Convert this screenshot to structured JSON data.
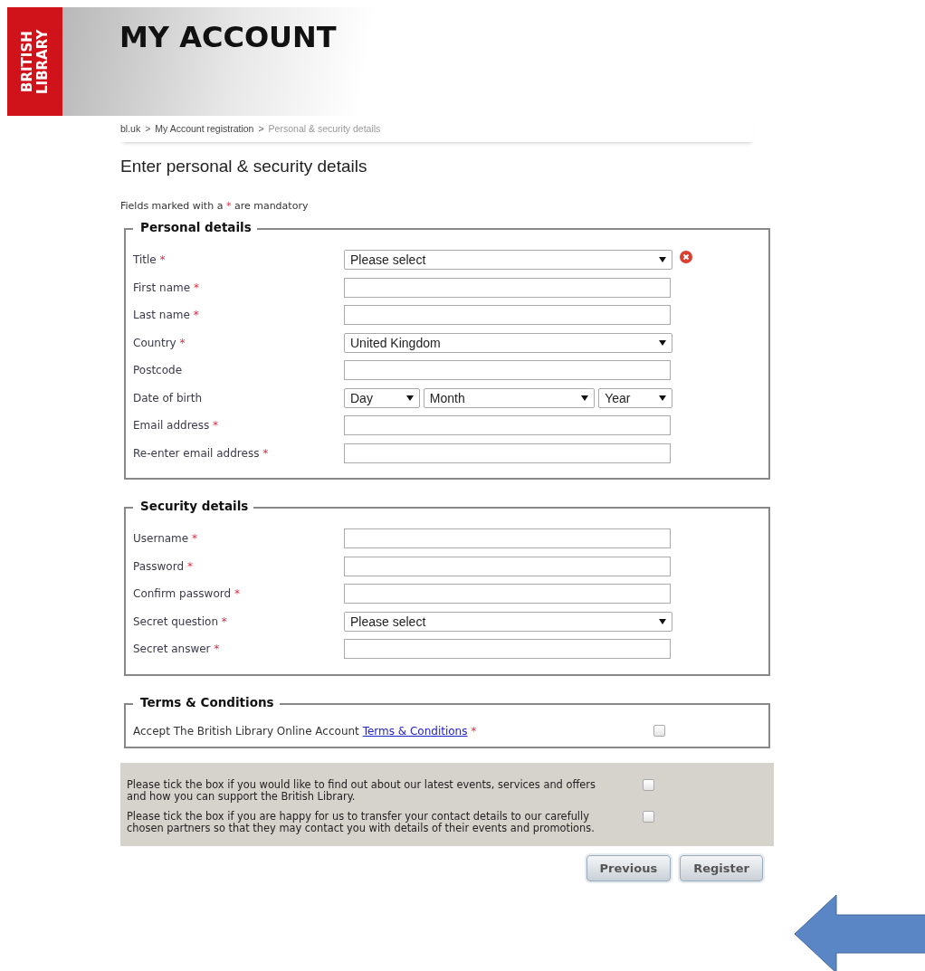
{
  "logo": [
    "BRITISH",
    "LIBRARY"
  ],
  "header": {
    "title": "MY ACCOUNT"
  },
  "breadcrumb": [
    {
      "label": "bl.uk",
      "current": false
    },
    {
      "label": "My Account registration",
      "current": false
    },
    {
      "label": "Personal & security details",
      "current": true
    }
  ],
  "breadcrumb_separator": ">",
  "page_title": "Enter personal & security details",
  "mandatory_note": {
    "before": "Fields marked with a",
    "mark": "*",
    "after": "are mandatory"
  },
  "sections": [
    {
      "legend": "Personal details",
      "fields": [
        {
          "label": "Title",
          "mark": "*",
          "kind": "select",
          "value": "Please select",
          "error": true
        },
        {
          "label": "First name",
          "mark": "*",
          "kind": "text"
        },
        {
          "label": "Last name",
          "mark": "*",
          "kind": "text"
        },
        {
          "label": "Country",
          "mark": "*",
          "kind": "select",
          "value": "United Kingdom"
        },
        {
          "label": "Postcode",
          "kind": "text"
        },
        {
          "label": "Date of birth",
          "kind": "date",
          "parts": [
            "Day",
            "Month",
            "Year"
          ]
        },
        {
          "label": "Email address",
          "mark": "*",
          "kind": "text"
        },
        {
          "label": "Re-enter email address",
          "mark": "*",
          "kind": "text"
        }
      ]
    },
    {
      "legend": "Security details",
      "fields": [
        {
          "label": "Username",
          "mark": "*",
          "kind": "text"
        },
        {
          "label": "Password",
          "mark": "*",
          "kind": "text"
        },
        {
          "label": "Confirm password",
          "mark": "*",
          "kind": "text"
        },
        {
          "label": "Secret question",
          "mark": "*",
          "kind": "select",
          "value": "Please select"
        },
        {
          "label": "Secret answer",
          "mark": "*",
          "kind": "text"
        }
      ]
    }
  ],
  "terms": {
    "legend": "Terms & Conditions",
    "text": "Accept The British Library Online Account",
    "link": "Terms & Conditions",
    "mark": "*",
    "checked": false
  },
  "preferences": [
    {
      "text": "Please tick the box if you would like to find out about our latest events, services and offers and how you can support the British Library.",
      "checked": false
    },
    {
      "text": "Please tick the box if you are happy for us to transfer your contact details to our carefully chosen partners so that they may contact you with details of their events and promotions.",
      "checked": false
    }
  ],
  "buttons": [
    "Previous",
    "Register"
  ]
}
